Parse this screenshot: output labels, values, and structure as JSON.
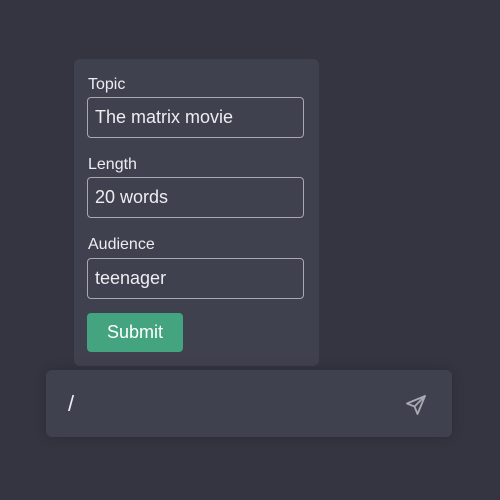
{
  "form": {
    "fields": [
      {
        "label": "Topic",
        "value": "The matrix movie"
      },
      {
        "label": "Length",
        "value": "20 words"
      },
      {
        "label": "Audience",
        "value": "teenager"
      }
    ],
    "submit_label": "Submit",
    "colors": {
      "accent": "#43a47f",
      "card_bg": "#40414f",
      "page_bg": "#343541"
    }
  },
  "chat": {
    "input_value": "/",
    "send_icon": "send-icon"
  }
}
